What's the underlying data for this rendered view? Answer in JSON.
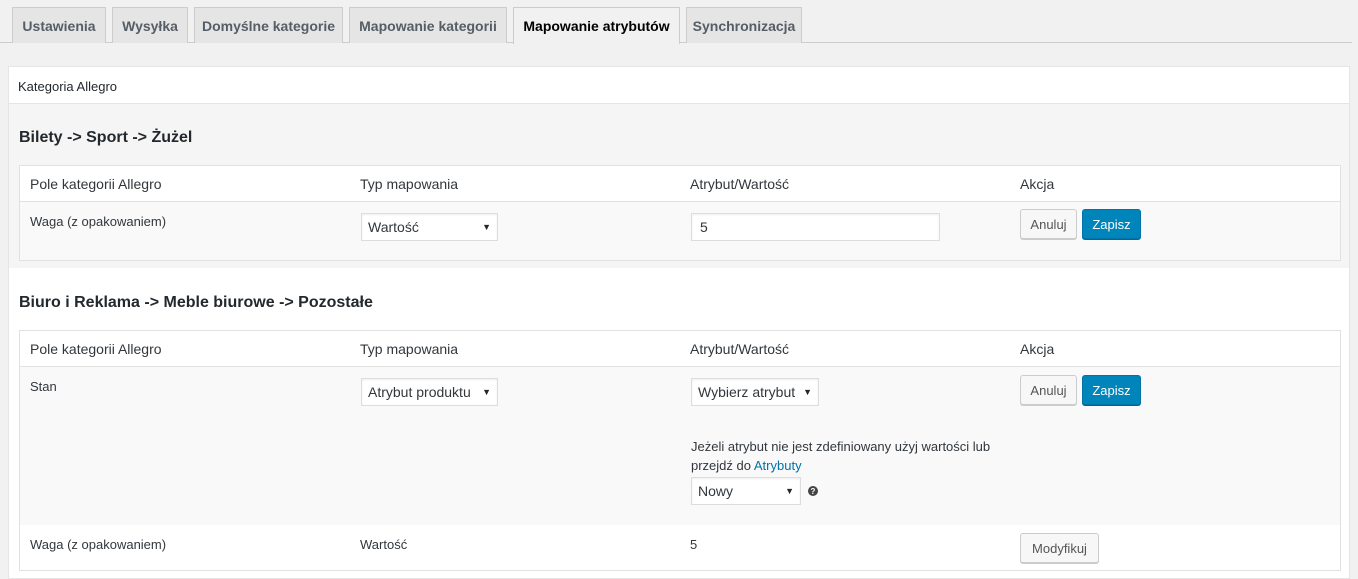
{
  "tabs": [
    {
      "label": "Ustawienia"
    },
    {
      "label": "Wysyłka"
    },
    {
      "label": "Domyślne kategorie"
    },
    {
      "label": "Mapowanie kategorii"
    },
    {
      "label": "Mapowanie atrybutów",
      "active": true
    },
    {
      "label": "Synchronizacja"
    }
  ],
  "panel": {
    "header": "Kategoria Allegro"
  },
  "columns": {
    "field": "Pole kategorii Allegro",
    "type": "Typ mapowania",
    "value": "Atrybut/Wartość",
    "action": "Akcja"
  },
  "sections": [
    {
      "title": "Bilety -> Sport -> Żużel",
      "rows": [
        {
          "field": "Waga (z opakowaniem)",
          "type_select": "Wartość",
          "value_input": "5",
          "cancel_label": "Anuluj",
          "save_label": "Zapisz"
        }
      ]
    },
    {
      "title": "Biuro i Reklama -> Meble biurowe -> Pozostałe",
      "rows": [
        {
          "field": "Stan",
          "type_select": "Atrybut produktu",
          "attribute_select": "Wybierz atrybut",
          "note_text": "Jeżeli atrybut nie jest zdefiniowany użyj wartości lub przejdź do",
          "note_link": "Atrybuty",
          "fallback_select": "Nowy",
          "help_glyph": "?",
          "cancel_label": "Anuluj",
          "save_label": "Zapisz"
        },
        {
          "field": "Waga (z opakowaniem)",
          "type_text": "Wartość",
          "value_text": "5",
          "modify_label": "Modyfikuj"
        }
      ]
    }
  ],
  "icons": {
    "dropdown_arrow": "▼",
    "help": "question-circle-icon"
  },
  "colors": {
    "primary_button": "#0085ba",
    "link": "#0073aa",
    "page_bg": "#f1f1f1"
  }
}
